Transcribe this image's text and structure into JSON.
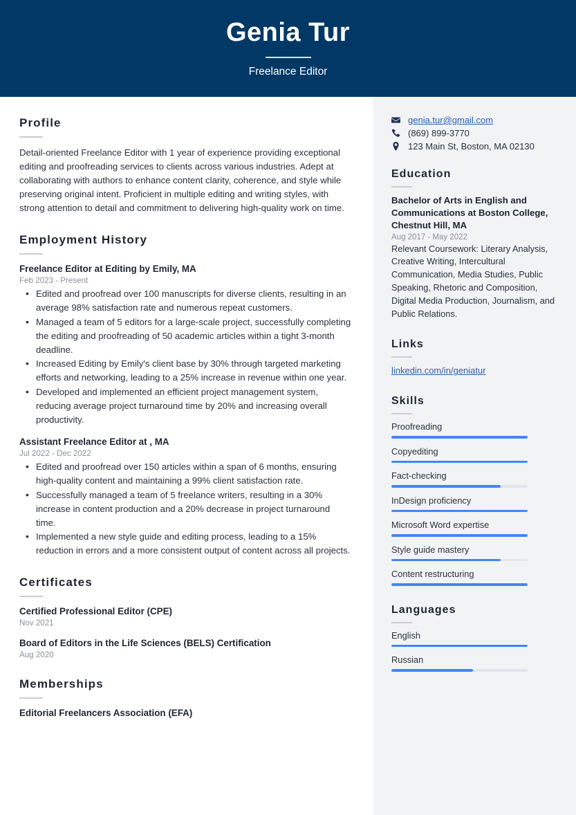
{
  "header": {
    "name": "Genia Tur",
    "job_title": "Freelance Editor",
    "background_color": "#023865"
  },
  "main": {
    "profile": {
      "heading": "Profile",
      "text": "Detail-oriented Freelance Editor with 1 year of experience providing exceptional editing and proofreading services to clients across various industries. Adept at collaborating with authors to enhance content clarity, coherence, and style while preserving original intent. Proficient in multiple editing and writing styles, with strong attention to detail and commitment to delivering high-quality work on time."
    },
    "employment": {
      "heading": "Employment History",
      "jobs": [
        {
          "title": "Freelance Editor at Editing by Emily, MA",
          "date": "Feb 2023 - Present",
          "bullets": [
            "Edited and proofread over 100 manuscripts for diverse clients, resulting in an average 98% satisfaction rate and numerous repeat customers.",
            "Managed a team of 5 editors for a large-scale project, successfully completing the editing and proofreading of 50 academic articles within a tight 3-month deadline.",
            "Increased Editing by Emily's client base by 30% through targeted marketing efforts and networking, leading to a 25% increase in revenue within one year.",
            "Developed and implemented an efficient project management system, reducing average project turnaround time by 20% and increasing overall productivity."
          ]
        },
        {
          "title": "Assistant Freelance Editor at , MA",
          "date": "Jul 2022 - Dec 2022",
          "bullets": [
            "Edited and proofread over 150 articles within a span of 6 months, ensuring high-quality content and maintaining a 99% client satisfaction rate.",
            "Successfully managed a team of 5 freelance writers, resulting in a 30% increase in content production and a 20% decrease in project turnaround time.",
            "Implemented a new style guide and editing process, leading to a 15% reduction in errors and a more consistent output of content across all projects."
          ]
        }
      ]
    },
    "certificates": {
      "heading": "Certificates",
      "items": [
        {
          "title": "Certified Professional Editor (CPE)",
          "date": "Nov 2021"
        },
        {
          "title": "Board of Editors in the Life Sciences (BELS) Certification",
          "date": "Aug 2020"
        }
      ]
    },
    "memberships": {
      "heading": "Memberships",
      "items": [
        {
          "title": "Editorial Freelancers Association (EFA)"
        }
      ]
    }
  },
  "sidebar": {
    "contact": [
      {
        "icon": "envelope-icon",
        "value": "genia.tur@gmail.com",
        "is_link": true
      },
      {
        "icon": "phone-icon",
        "value": "(869) 899-3770",
        "is_link": false
      },
      {
        "icon": "map-pin-icon",
        "value": "123 Main St, Boston, MA 02130",
        "is_link": false
      }
    ],
    "education": {
      "heading": "Education",
      "degree": "Bachelor of Arts in English and Communications at Boston College, Chestnut Hill, MA",
      "date": "Aug 2017 - May 2022",
      "description": "Relevant Coursework: Literary Analysis, Creative Writing, Intercultural Communication, Media Studies, Public Speaking, Rhetoric and Composition, Digital Media Production, Journalism, and Public Relations."
    },
    "links": {
      "heading": "Links",
      "items": [
        {
          "label": "linkedin.com/in/geniatur"
        }
      ]
    },
    "skills": {
      "heading": "Skills",
      "accent_color": "#4285f4",
      "items": [
        {
          "label": "Proofreading",
          "level": 100
        },
        {
          "label": "Copyediting",
          "level": 100
        },
        {
          "label": "Fact-checking",
          "level": 80
        },
        {
          "label": "InDesign proficiency",
          "level": 100
        },
        {
          "label": "Microsoft Word expertise",
          "level": 100
        },
        {
          "label": "Style guide mastery",
          "level": 80
        },
        {
          "label": "Content restructuring",
          "level": 100
        }
      ]
    },
    "languages": {
      "heading": "Languages",
      "items": [
        {
          "label": "English",
          "level": 100
        },
        {
          "label": "Russian",
          "level": 60
        }
      ]
    }
  }
}
